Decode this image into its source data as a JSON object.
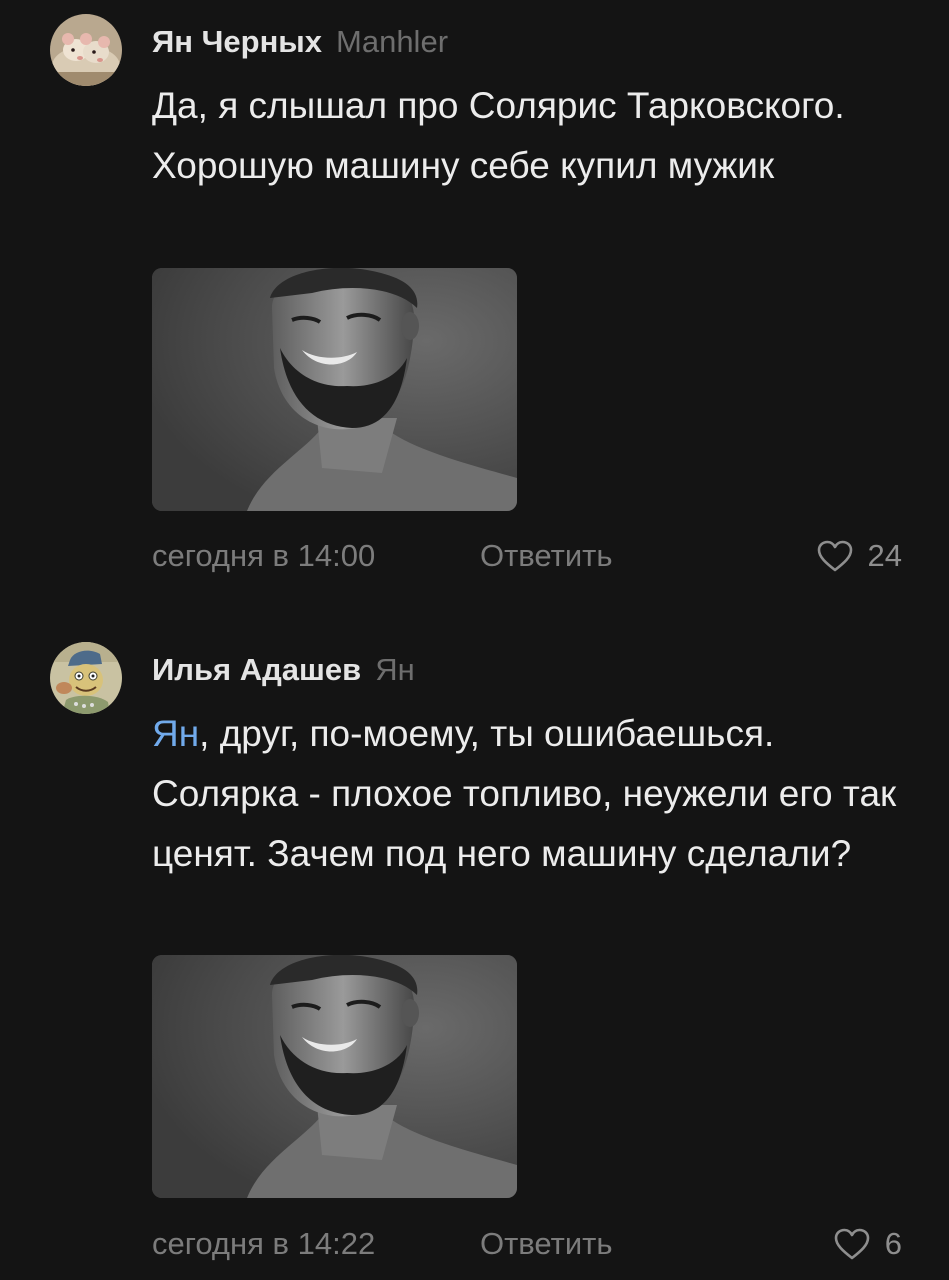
{
  "comments": [
    {
      "author": "Ян Черных",
      "reply_to": "Manhler",
      "mention": "",
      "text_after_mention": "Да, я слышал про Солярис Тарковского. Хорошую машину себе купил мужик",
      "time": "сегодня в 14:00",
      "reply_label": "Ответить",
      "likes": "24",
      "avatar_icon": "rats-avatar-icon",
      "photo": "smiling-bearded-man-photo"
    },
    {
      "author": "Илья Адашев",
      "reply_to": "Ян",
      "mention": "Ян",
      "text_after_mention": ", друг, по-моему, ты ошибаешься. Солярка - плохое топливо, неужели его так ценят. Зачем под него машину сделали?",
      "time": "сегодня в 14:22",
      "reply_label": "Ответить",
      "likes": "6",
      "avatar_icon": "illustrated-character-avatar-icon",
      "photo": "smiling-bearded-man-photo"
    }
  ],
  "colors": {
    "background": "#141414",
    "mention": "#71aaeb",
    "secondary_text": "#7c7c7c"
  }
}
